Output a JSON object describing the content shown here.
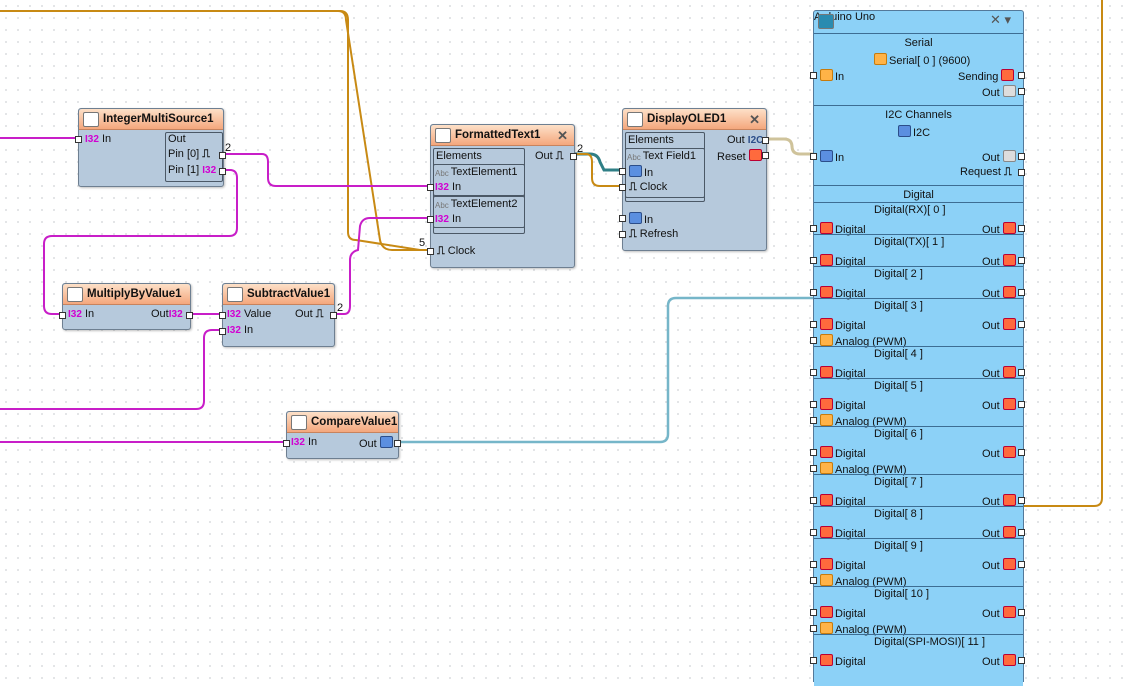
{
  "components": {
    "integer_multi_source": {
      "title": "IntegerMultiSource1",
      "in_type": "I32",
      "in_label": "In",
      "out_label": "Out",
      "pin0_label": "Pin [0]",
      "pin1_label": "Pin [1]",
      "pin1_type": "I32",
      "pin0_count": "2"
    },
    "formatted_text": {
      "title": "FormattedText1",
      "elements_label": "Elements",
      "out_label": "Out",
      "out_count": "2",
      "te1_label": "TextElement1",
      "te1_in_type": "I32",
      "te1_in": "In",
      "te2_label": "TextElement2",
      "te2_in_type": "I32",
      "te2_in": "In",
      "clock_label": "Clock",
      "clock_count": "5"
    },
    "display_oled": {
      "title": "DisplayOLED1",
      "elements_label": "Elements",
      "out_label": "Out",
      "out_type": "I2C",
      "reset_label": "Reset",
      "field_label": "Text Field1",
      "field_in": "In",
      "field_clock": "Clock",
      "in_label": "In",
      "refresh_label": "Refresh"
    },
    "multiply_by_value": {
      "title": "MultiplyByValue1",
      "in_type": "I32",
      "in_label": "In",
      "out_label": "Out",
      "out_type": "I32"
    },
    "subtract_value": {
      "title": "SubtractValue1",
      "value_type": "I32",
      "value_label": "Value",
      "in_type": "I32",
      "in_label": "In",
      "out_label": "Out",
      "out_count": "2"
    },
    "compare_value": {
      "title": "CompareValue1",
      "in_type": "I32",
      "in_label": "In",
      "out_label": "Out"
    }
  },
  "arduino": {
    "title": "Arduino Uno",
    "serial_section": "Serial",
    "serial_sub": "Serial[ 0 ] (9600)",
    "serial_in": "In",
    "serial_sending": "Sending",
    "serial_out": "Out",
    "i2c_section": "I2C Channels",
    "i2c_sub": "I2C",
    "i2c_in": "In",
    "i2c_out": "Out",
    "i2c_request": "Request",
    "digital_section": "Digital",
    "digital_label": "Digital",
    "out_label": "Out",
    "analog_label": "Analog (PWM)",
    "pins": [
      {
        "name": "Digital(RX)[ 0 ]",
        "analog": false
      },
      {
        "name": "Digital(TX)[ 1 ]",
        "analog": false
      },
      {
        "name": "Digital[ 2 ]",
        "analog": false
      },
      {
        "name": "Digital[ 3 ]",
        "analog": true
      },
      {
        "name": "Digital[ 4 ]",
        "analog": false
      },
      {
        "name": "Digital[ 5 ]",
        "analog": true
      },
      {
        "name": "Digital[ 6 ]",
        "analog": true
      },
      {
        "name": "Digital[ 7 ]",
        "analog": false
      },
      {
        "name": "Digital[ 8 ]",
        "analog": false
      },
      {
        "name": "Digital[ 9 ]",
        "analog": true
      },
      {
        "name": "Digital[ 10 ]",
        "analog": true
      },
      {
        "name": "Digital(SPI-MOSI)[ 11 ]",
        "analog": false
      }
    ]
  },
  "colors": {
    "wire_int": "#c81ec8",
    "wire_clock": "#c88a14",
    "wire_bool": "#76b6c9",
    "wire_i2c": "#cfc39b",
    "wire_text": "#2f7f86",
    "arduino_body": "#8cd1f7",
    "component_body": "#b6c9dc"
  }
}
